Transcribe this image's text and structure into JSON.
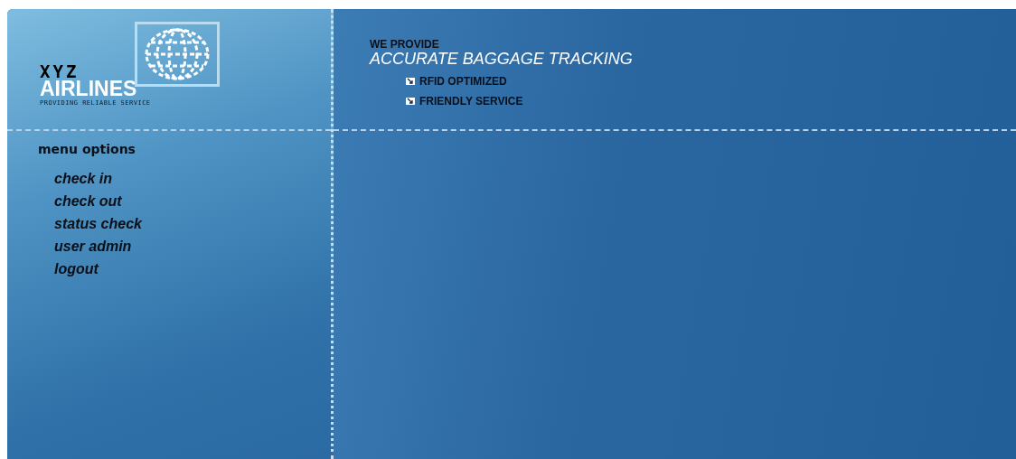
{
  "logo": {
    "name_top": "XYZ",
    "name_bottom": "AIRLINES",
    "tagline": "PROVIDING RELIABLE SERVICE"
  },
  "banner": {
    "kicker": "WE PROVIDE",
    "headline": "ACCURATE BAGGAGE TRACKING",
    "features": [
      "RFID OPTIMIZED",
      "FRIENDLY SERVICE"
    ]
  },
  "menu": {
    "title": "menu options",
    "items": [
      "check in",
      "check out",
      "status check",
      "user admin",
      "logout"
    ]
  }
}
